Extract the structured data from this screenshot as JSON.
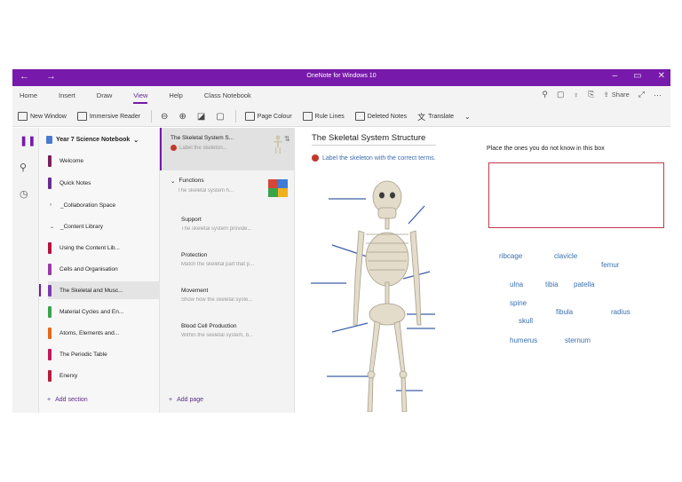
{
  "titlebar": {
    "title": "OneNote for Windows 10"
  },
  "menu": {
    "tabs": [
      "Home",
      "Insert",
      "Draw",
      "View",
      "Help",
      "Class Notebook"
    ],
    "active": "View",
    "share_label": "Share"
  },
  "ribbon": {
    "new_window": "New Window",
    "immersive_reader": "Immersive Reader",
    "page_colour": "Page Colour",
    "rule_lines": "Rule Lines",
    "deleted_notes": "Deleted Notes",
    "translate": "Translate"
  },
  "notebook": {
    "name": "Year 7 Science Notebook",
    "sections": [
      {
        "label": "Welcome",
        "color": "#7a1f5c"
      },
      {
        "label": "Quick Notes",
        "color": "#6b2d90"
      },
      {
        "label": "_Collaboration Space",
        "group": true,
        "chevron": "›"
      },
      {
        "label": "_Content Library",
        "group": true,
        "chevron": "⌄"
      },
      {
        "label": "Using the Content Lib...",
        "color": "#b5123e"
      },
      {
        "label": "Cells and Organisation",
        "color": "#9a3aa6"
      },
      {
        "label": "The Skeletal and Musc...",
        "color": "#7d3cb0",
        "selected": true
      },
      {
        "label": "Material Cycles and En...",
        "color": "#3aa34a"
      },
      {
        "label": "Atoms, Elements and...",
        "color": "#e8671a"
      },
      {
        "label": "The Periodic Table",
        "color": "#c2185b"
      },
      {
        "label": "Enerxy",
        "color": "#b71c3a"
      }
    ],
    "add_section": "Add section"
  },
  "pages": {
    "items": [
      {
        "title": "The Skeletal System S...",
        "snippet": "Label the skeleton...",
        "selected": true
      },
      {
        "title": "Functions",
        "snippet": "The skeletal system h...",
        "expandable": true
      },
      {
        "title": "Support",
        "snippet": "The skeletal system provide..."
      },
      {
        "title": "Protection",
        "snippet": "Match the skeletal part that p..."
      },
      {
        "title": "Movement",
        "snippet": "Show how the skeletal syste..."
      },
      {
        "title": "Blood Cell Production",
        "snippet": "Within the skeletal system, b..."
      }
    ],
    "add_page": "Add page"
  },
  "canvas": {
    "title": "The Skeletal System Structure",
    "instruction": "Label the skeleton with the correct terms.",
    "box_label": "Place the ones you do not know in this box",
    "words": [
      "ribcage",
      "clavicle",
      "femur",
      "ulna",
      "tibia",
      "patella",
      "spine",
      "fibula",
      "radius",
      "skull",
      "humerus",
      "sternum"
    ]
  },
  "colors": {
    "accent": "#7719aa",
    "link": "#3a6fb0",
    "box_border": "#c0394b"
  }
}
